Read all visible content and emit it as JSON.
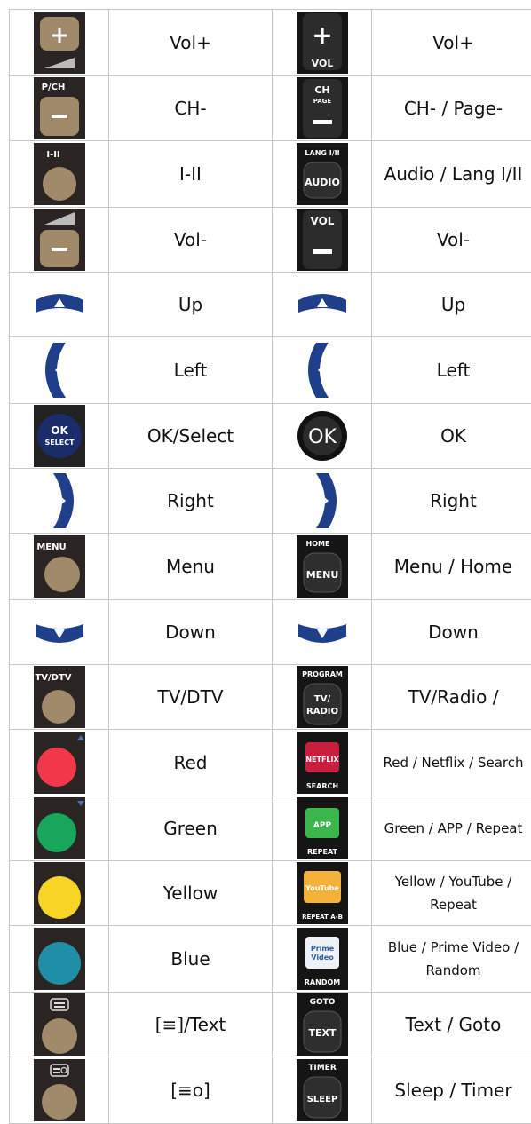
{
  "rows": [
    {
      "left": {
        "label": "Vol+",
        "icon": "vol-plus-icon",
        "button_text": ""
      },
      "right": {
        "label": "Vol+",
        "icon": "vol-plus-icon",
        "button_text": "VOL"
      }
    },
    {
      "left": {
        "label": "CH-",
        "icon": "ch-minus-icon",
        "button_text": "P/CH"
      },
      "right": {
        "label": "CH- / Page-",
        "icon": "ch-minus-icon",
        "button_text": "CH PAGE"
      }
    },
    {
      "left": {
        "label": "I-II",
        "icon": "audio-icon",
        "button_text": "I-II"
      },
      "right": {
        "label": "Audio / Lang I/II",
        "icon": "audio-icon",
        "button_text": "AUDIO",
        "caption": "LANG I/II"
      }
    },
    {
      "left": {
        "label": "Vol-",
        "icon": "vol-minus-icon",
        "button_text": ""
      },
      "right": {
        "label": "Vol-",
        "icon": "vol-minus-icon",
        "button_text": "VOL"
      }
    },
    {
      "left": {
        "label": "Up",
        "icon": "arrow-up-icon"
      },
      "right": {
        "label": "Up",
        "icon": "arrow-up-icon"
      }
    },
    {
      "left": {
        "label": "Left",
        "icon": "arrow-left-icon"
      },
      "right": {
        "label": "Left",
        "icon": "arrow-left-icon"
      }
    },
    {
      "left": {
        "label": "OK/Select",
        "icon": "ok-icon",
        "button_text": "OK SELECT"
      },
      "right": {
        "label": "OK",
        "icon": "ok-icon",
        "button_text": "OK"
      }
    },
    {
      "left": {
        "label": "Right",
        "icon": "arrow-right-icon"
      },
      "right": {
        "label": "Right",
        "icon": "arrow-right-icon"
      }
    },
    {
      "left": {
        "label": "Menu",
        "icon": "menu-icon",
        "button_text": "MENU"
      },
      "right": {
        "label": "Menu / Home",
        "icon": "menu-icon",
        "button_text": "MENU",
        "caption": "HOME"
      }
    },
    {
      "left": {
        "label": "Down",
        "icon": "arrow-down-icon"
      },
      "right": {
        "label": "Down",
        "icon": "arrow-down-icon"
      }
    },
    {
      "left": {
        "label": "TV/DTV",
        "icon": "tv-icon",
        "button_text": "TV/DTV"
      },
      "right": {
        "label": "TV/Radio /",
        "icon": "tv-icon",
        "button_text": "TV/ RADIO",
        "caption": "PROGRAM"
      }
    },
    {
      "left": {
        "label": "Red",
        "icon": "red-button-icon"
      },
      "right": {
        "label": "Red / Netflix / Search",
        "icon": "netflix-icon",
        "button_text": "NETFLIX",
        "caption": "SEARCH"
      }
    },
    {
      "left": {
        "label": "Green",
        "icon": "green-button-icon"
      },
      "right": {
        "label": "Green / APP / Repeat",
        "icon": "app-icon",
        "button_text": "APP",
        "caption": "REPEAT"
      }
    },
    {
      "left": {
        "label": "Yellow",
        "icon": "yellow-button-icon"
      },
      "right": {
        "label": "Yellow / YouTube / Repeat",
        "icon": "youtube-icon",
        "button_text": "YouTube",
        "caption": "REPEAT A-B"
      }
    },
    {
      "left": {
        "label": "Blue",
        "icon": "blue-button-icon"
      },
      "right": {
        "label": "Blue / Prime Video / Random",
        "icon": "prime-video-icon",
        "button_text": "Prime Video",
        "caption": "RANDOM"
      }
    },
    {
      "left": {
        "label": "[≡]/Text",
        "icon": "text-icon"
      },
      "right": {
        "label": "Text / Goto",
        "icon": "text-icon",
        "button_text": "TEXT",
        "caption": "GOTO"
      }
    },
    {
      "left": {
        "label": "[≡o]",
        "icon": "hold-icon"
      },
      "right": {
        "label": "Sleep / Timer",
        "icon": "sleep-icon",
        "button_text": "SLEEP",
        "caption": "TIMER"
      }
    }
  ],
  "colors": {
    "border": "#c8c8c8",
    "tan_button": "#a08a6a",
    "tan_body": "#2a2522",
    "black_body": "#151515",
    "navy": "#1f3f8a",
    "red": "#f0384a",
    "green": "#1aa65a",
    "yellow": "#f6d526",
    "teal": "#1f8ea6",
    "netflix": "#c81f3f",
    "app_green": "#3ab64a",
    "youtube": "#f4b23a",
    "prime": "#2e5ea3"
  }
}
